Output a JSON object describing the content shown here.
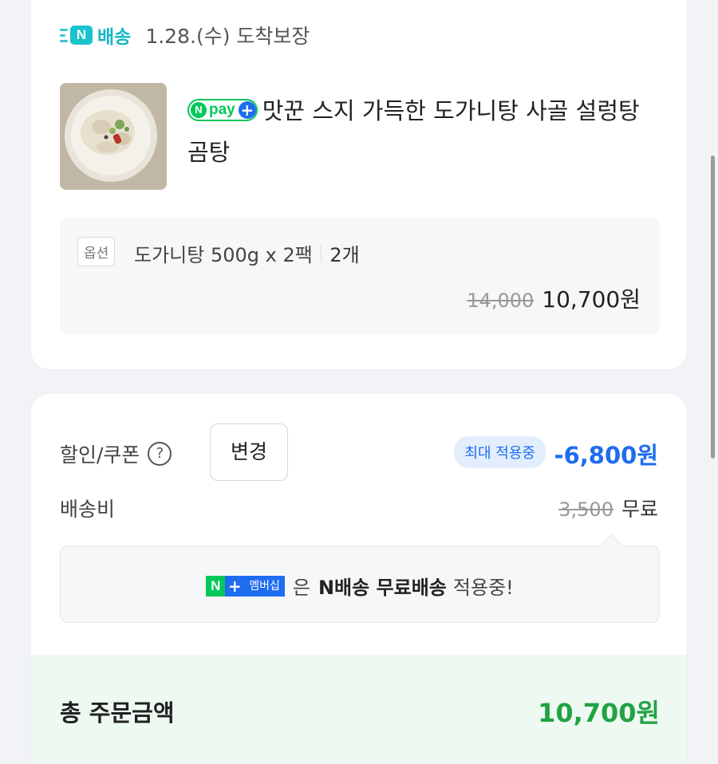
{
  "delivery": {
    "badge_letter": "N",
    "badge_label": "배송",
    "arrival_text": "1.28.(수) 도착보장"
  },
  "product": {
    "npay_n": "N",
    "npay_text": "pay",
    "npay_plus": "+",
    "title": "맛꾼 스지 가득한 도가니탕 사골 설렁탕 곰탕",
    "thumbnail_icon": "food-photo-icon"
  },
  "option": {
    "tag": "옵션",
    "name": "도가니탕 500g x 2팩",
    "quantity": "2개",
    "original_price": "14,000",
    "sale_price": "10,700원"
  },
  "payment": {
    "coupon_label": "할인/쿠폰",
    "help_symbol": "?",
    "change_button": "변경",
    "max_badge": "최대 적용중",
    "discount_amount": "-6,800원",
    "shipping_label": "배송비",
    "shipping_original": "3,500",
    "shipping_free": "무료",
    "membership": {
      "n": "N",
      "plus": "+",
      "label": "멤버십",
      "text_particle": "은",
      "text_bold": "N배송 무료배송",
      "text_tail": "적용중!"
    },
    "total_label": "총 주문금액",
    "total_amount": "10,700원"
  },
  "colors": {
    "accent_blue": "#1e6cf0",
    "naver_green": "#03c75a",
    "delivery_teal": "#12b9c4",
    "total_green": "#22a244"
  }
}
